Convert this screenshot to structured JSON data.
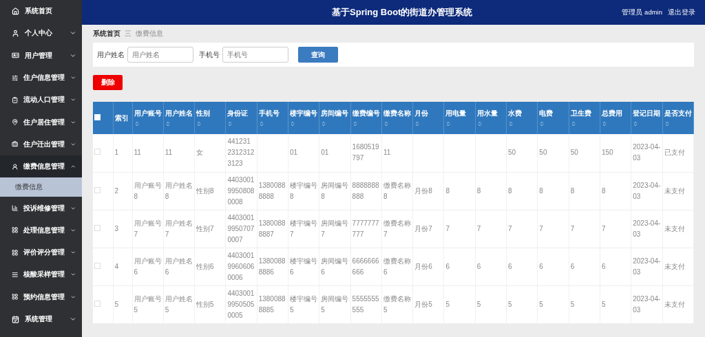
{
  "header": {
    "title": "基于Spring Boot的街道办管理系统",
    "user": "管理员 admin",
    "logout": "退出登录"
  },
  "sidebar": {
    "items": [
      {
        "label": "系统首页",
        "expandable": false,
        "expanded": false
      },
      {
        "label": "个人中心",
        "expandable": true,
        "expanded": false
      },
      {
        "label": "用户管理",
        "expandable": true,
        "expanded": false
      },
      {
        "label": "住户信息管理",
        "expandable": true,
        "expanded": false
      },
      {
        "label": "流动人口管理",
        "expandable": true,
        "expanded": false
      },
      {
        "label": "住户居住管理",
        "expandable": true,
        "expanded": false
      },
      {
        "label": "住户迁出管理",
        "expandable": true,
        "expanded": false
      },
      {
        "label": "缴费信息管理",
        "expandable": true,
        "expanded": true,
        "children": [
          {
            "label": "缴费信息",
            "selected": true
          }
        ]
      },
      {
        "label": "投诉维修管理",
        "expandable": true,
        "expanded": false
      },
      {
        "label": "处理信息管理",
        "expandable": true,
        "expanded": false
      },
      {
        "label": "评价评分管理",
        "expandable": true,
        "expanded": false
      },
      {
        "label": "核酸采样管理",
        "expandable": true,
        "expanded": false
      },
      {
        "label": "预约信息管理",
        "expandable": true,
        "expanded": false
      },
      {
        "label": "系统管理",
        "expandable": true,
        "expanded": false
      }
    ]
  },
  "breadcrumb": {
    "home": "系统首页",
    "separator": "三",
    "current": "缴费信息"
  },
  "search": {
    "fields": [
      {
        "label": "用户姓名",
        "placeholder": "用户姓名"
      },
      {
        "label": "手机号",
        "placeholder": "手机号"
      }
    ],
    "button": "查询"
  },
  "delete_button": "删除",
  "table": {
    "all_checked": false,
    "columns": [
      {
        "label": "索引",
        "sortable": false
      },
      {
        "label": "用户账号",
        "sortable": true
      },
      {
        "label": "用户姓名",
        "sortable": true
      },
      {
        "label": "性别",
        "sortable": true
      },
      {
        "label": "身份证",
        "sortable": true
      },
      {
        "label": "手机号",
        "sortable": true
      },
      {
        "label": "楼宇编号",
        "sortable": true
      },
      {
        "label": "房间编号",
        "sortable": true
      },
      {
        "label": "缴费编号",
        "sortable": true
      },
      {
        "label": "缴费名称",
        "sortable": true
      },
      {
        "label": "月份",
        "sortable": true
      },
      {
        "label": "用电量",
        "sortable": true
      },
      {
        "label": "用水量",
        "sortable": true
      },
      {
        "label": "水费",
        "sortable": true
      },
      {
        "label": "电费",
        "sortable": true
      },
      {
        "label": "卫生费",
        "sortable": true
      },
      {
        "label": "总费用",
        "sortable": true
      },
      {
        "label": "登记日期",
        "sortable": true
      },
      {
        "label": "是否支付",
        "sortable": true
      }
    ],
    "rows": [
      {
        "checked": false,
        "cells": [
          "1",
          "11",
          "11",
          "女",
          "441231 2312312 3123",
          "",
          "01",
          "01",
          "1680519 797",
          "11",
          "",
          "",
          "",
          "50",
          "50",
          "50",
          "150",
          "2023-04- 03",
          "已支付"
        ]
      },
      {
        "checked": false,
        "cells": [
          "2",
          "用户账号 8",
          "用户姓名 8",
          "性别8",
          "4403001 9950808 0008",
          "1380088 8888",
          "楼宇编号 8",
          "房间编号 8",
          "8888888 888",
          "缴费名称 8",
          "月份8",
          "8",
          "8",
          "8",
          "8",
          "8",
          "8",
          "2023-04- 03",
          "未支付"
        ]
      },
      {
        "checked": false,
        "cells": [
          "3",
          "用户账号 7",
          "用户姓名 7",
          "性别7",
          "4403001 9950707 0007",
          "1380088 8887",
          "楼宇编号 7",
          "房间编号 7",
          "7777777 777",
          "缴费名称 7",
          "月份7",
          "7",
          "7",
          "7",
          "7",
          "7",
          "7",
          "2023-04- 03",
          "未支付"
        ]
      },
      {
        "checked": false,
        "cells": [
          "4",
          "用户账号 6",
          "用户姓名 6",
          "性别6",
          "4403001 9960606 0006",
          "1380088 8886",
          "楼宇编号 6",
          "房间编号 6",
          "6666666 666",
          "缴费名称 6",
          "月份6",
          "6",
          "6",
          "6",
          "6",
          "6",
          "6",
          "2023-04- 03",
          "未支付"
        ]
      },
      {
        "checked": false,
        "cells": [
          "5",
          "用户账号 5",
          "用户姓名 5",
          "性别5",
          "4403001 9950505 0005",
          "1380088 8885",
          "楼宇编号 5",
          "房间编号 5",
          "5555555 555",
          "缴费名称 5",
          "月份5",
          "5",
          "5",
          "5",
          "5",
          "5",
          "5",
          "2023-04- 03",
          "未支付"
        ]
      }
    ]
  }
}
